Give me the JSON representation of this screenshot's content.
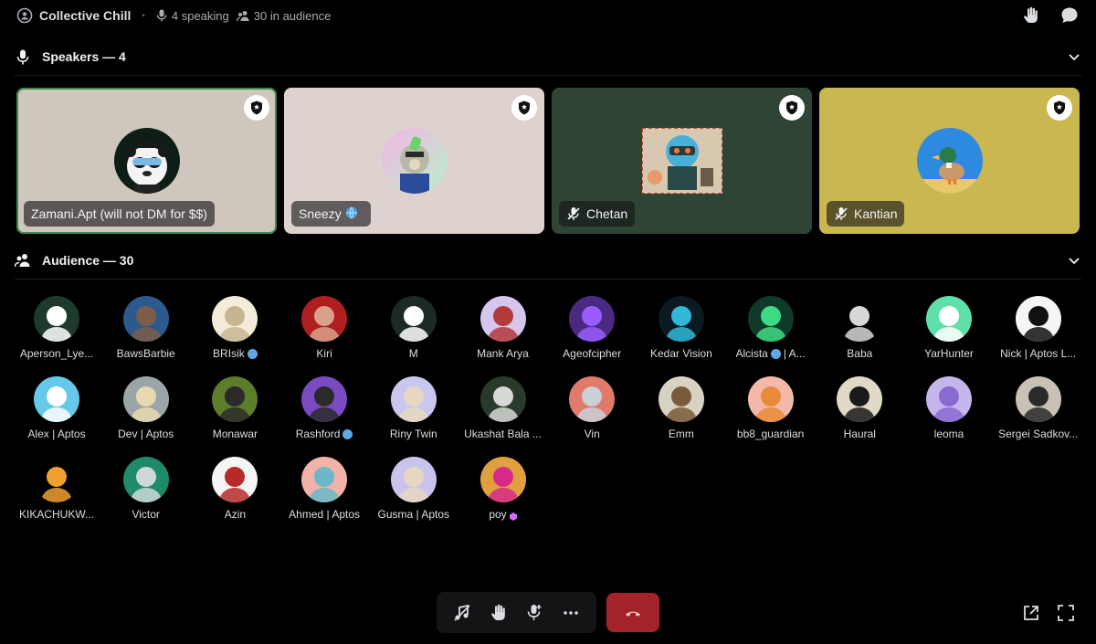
{
  "stage": {
    "title": "Collective Chill",
    "speaking": "4 speaking",
    "audience_count": "30 in audience"
  },
  "speakers_header": "Speakers — 4",
  "audience_header": "Audience — 30",
  "speakers": [
    {
      "name": "Zamani.Apt (will not DM for $$)",
      "bg": "#cfc6bd",
      "muted": false,
      "globe": false,
      "active": true,
      "avatar": "panda-avatar"
    },
    {
      "name": "Sneezy",
      "bg": "#ddd2cd",
      "muted": false,
      "globe": true,
      "active": false,
      "avatar": "ape-avatar"
    },
    {
      "name": "Chetan",
      "bg": "#2e4434",
      "muted": true,
      "globe": false,
      "active": false,
      "avatar": "robot-avatar"
    },
    {
      "name": "Kantian",
      "bg": "#cbb74f",
      "muted": true,
      "globe": false,
      "active": false,
      "avatar": "duck-avatar"
    }
  ],
  "audience": [
    {
      "name": "Aperson_Lye...",
      "bg": "#1d3a2b",
      "fg": "#ffffff"
    },
    {
      "name": "BawsBarbie",
      "bg": "#2c5a8c",
      "fg": "#7b5e4a"
    },
    {
      "name": "BRIsik",
      "bg": "#f3ecd9",
      "fg": "#c8b58f",
      "globe": true
    },
    {
      "name": "Kiri",
      "bg": "#b01f20",
      "fg": "#d9a18a"
    },
    {
      "name": "M",
      "bg": "#1b2a22",
      "fg": "#ffffff"
    },
    {
      "name": "Mank Arya",
      "bg": "#d6c6ee",
      "fg": "#b33a3a"
    },
    {
      "name": "Ageofcipher",
      "bg": "#4a2a80",
      "fg": "#9b5cff"
    },
    {
      "name": "Kedar Vision",
      "bg": "#0b1a22",
      "fg": "#2fb8d8"
    },
    {
      "name": "Alcista",
      "bg": "#0f3a2a",
      "fg": "#3ddc84",
      "globe": true,
      "suffix": "| A..."
    },
    {
      "name": "Baba",
      "bg": "#000000",
      "fg": "#d8d8d8"
    },
    {
      "name": "YarHunter",
      "bg": "#5fe0a8",
      "fg": "#ffffff"
    },
    {
      "name": "Nick | Aptos L...",
      "bg": "#f5f5f5",
      "fg": "#111111"
    },
    {
      "name": "Alex | Aptos",
      "bg": "#67c9ea",
      "fg": "#ffffff"
    },
    {
      "name": "Dev | Aptos",
      "bg": "#9aa5a8",
      "fg": "#e8d9b0"
    },
    {
      "name": "Monawar",
      "bg": "#5c7d2a",
      "fg": "#2a2a2a"
    },
    {
      "name": "Rashford",
      "bg": "#7a4ac2",
      "fg": "#2a2a2a",
      "globe": true
    },
    {
      "name": "Riny Twin",
      "bg": "#c9c6f0",
      "fg": "#e6d8c0"
    },
    {
      "name": "Ukashat Bala ...",
      "bg": "#2a3a2a",
      "fg": "#d8d8d8"
    },
    {
      "name": "Vin",
      "bg": "#e07a6a",
      "fg": "#c9d0d8"
    },
    {
      "name": "Emm",
      "bg": "#d8d2c2",
      "fg": "#7a5a3a"
    },
    {
      "name": "bb8_guardian",
      "bg": "#f4b8a8",
      "fg": "#e88a3a"
    },
    {
      "name": "Haural",
      "bg": "#e2d8c6",
      "fg": "#1a1a1a"
    },
    {
      "name": "leoma",
      "bg": "#c4b6ec",
      "fg": "#8a6ad0"
    },
    {
      "name": "Sergei Sadkov...",
      "bg": "#c9c2b4",
      "fg": "#2a2a2a"
    },
    {
      "name": "KIKACHUKW...",
      "bg": "#000000",
      "fg": "#f0a030"
    },
    {
      "name": "Victor",
      "bg": "#1e8a6a",
      "fg": "#cfd8d8"
    },
    {
      "name": "Azin",
      "bg": "#f5f5f5",
      "fg": "#b82a2a"
    },
    {
      "name": "Ahmed | Aptos",
      "bg": "#f2b2a8",
      "fg": "#6ab8c8"
    },
    {
      "name": "Gusma | Aptos",
      "bg": "#c9c4ee",
      "fg": "#e6d8c0"
    },
    {
      "name": "poy",
      "bg": "#e0a040",
      "fg": "#d62a8a",
      "boost": true
    }
  ],
  "colors": {
    "leave_red": "#a3232a",
    "active_outline": "#3b8a4a",
    "globe_blue": "#5fa8e6"
  }
}
